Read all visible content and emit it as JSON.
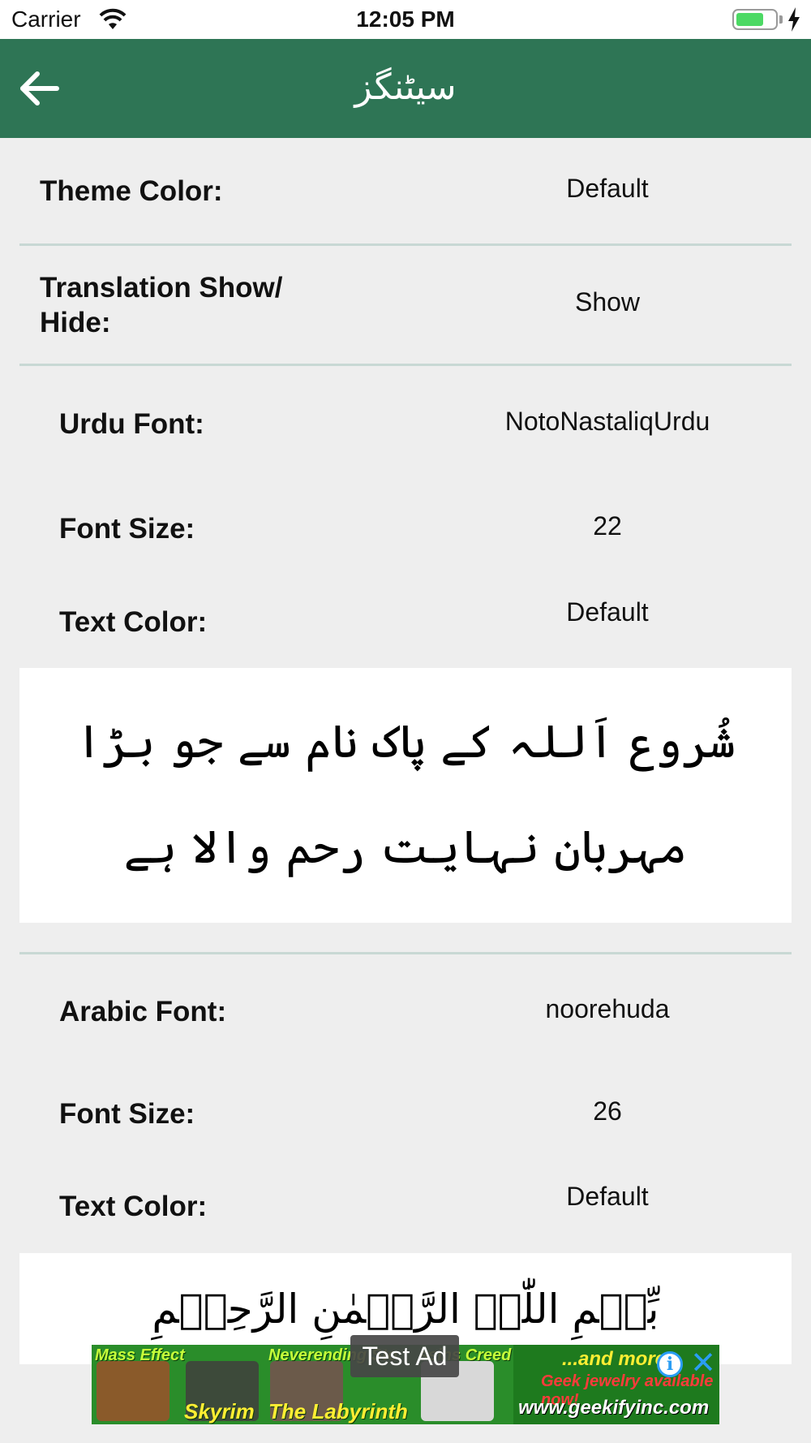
{
  "status_bar": {
    "carrier": "Carrier",
    "time": "12:05 PM",
    "battery_level": 0.72,
    "battery_color": "#4cd964"
  },
  "nav": {
    "back_icon": "arrow-left-icon",
    "title": "سیٹنگز",
    "background_color": "#2e7555"
  },
  "settings": {
    "theme_color": {
      "label": "Theme Color:",
      "value": "Default"
    },
    "translation": {
      "label": "Translation Show/ Hide:",
      "value": "Show"
    },
    "urdu": {
      "font_label": "Urdu Font:",
      "font_value": "NotoNastaliqUrdu",
      "size_label": "Font Size:",
      "size_value": "22",
      "color_label": "Text Color:",
      "color_value": "Default",
      "preview_text": "شُروع اَللہ کے پاک نام سے جو بڑا مہربان نہایت رحم والا ہے"
    },
    "arabic": {
      "font_label": "Arabic Font:",
      "font_value": "noorehuda",
      "size_label": "Font Size:",
      "size_value": "26",
      "color_label": "Text Color:",
      "color_value": "Default",
      "preview_text": "بِّسۡمِ اللّٰہِ الرَّحۡمٰنِ الرَّحِیۡمِ"
    }
  },
  "ad": {
    "test_label": "Test Ad",
    "tiles": [
      {
        "caption_top": "Mass Effect",
        "caption_bottom": ""
      },
      {
        "caption_top": "",
        "caption_bottom": "Skyrim"
      },
      {
        "caption_top": "Neverending Sto",
        "caption_bottom": "The Labyrinth"
      },
      {
        "caption_top": "ssins Creed",
        "caption_bottom": ""
      }
    ],
    "right_line1": "...and more",
    "right_line2": "Geek jewelry available now!",
    "right_line3": "www.geekifyinc.com",
    "info_icon": "info-icon",
    "close_icon": "close-icon"
  }
}
